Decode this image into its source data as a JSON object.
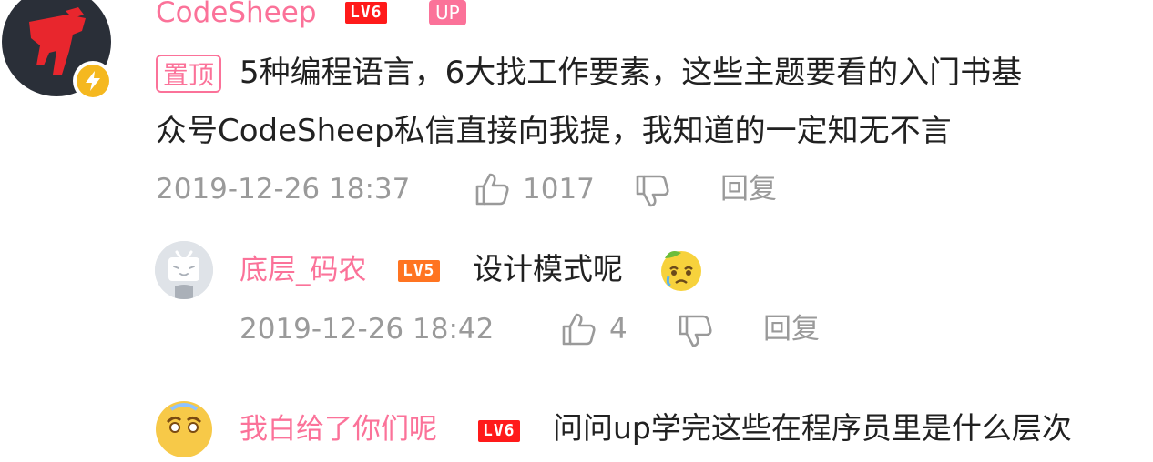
{
  "comment": {
    "username": "CodeSheep",
    "level": "LV6",
    "up_badge": "UP",
    "pin_label": "置顶",
    "content_line1": "5种编程语言，6大找工作要素，这些主题要看的入门书基",
    "content_line2": "众号CodeSheep私信直接向我提，我知道的一定知无不言",
    "timestamp": "2019-12-26 18:37",
    "like_count": "1017",
    "reply_label": "回复"
  },
  "replies": [
    {
      "username": "底层_码农",
      "level": "LV5",
      "text": "设计模式呢",
      "timestamp": "2019-12-26 18:42",
      "like_count": "4",
      "reply_label": "回复"
    },
    {
      "username": "我白给了你们呢",
      "level": "LV6",
      "text": "问问up学完这些在程序员里是什么层次"
    }
  ],
  "colors": {
    "accent_pink": "#fb7299",
    "meta_gray": "#9a9a9a",
    "text_dark": "#212121",
    "level6_red": "#ff1a1a",
    "level5_orange": "#ff7421",
    "verify_yellow": "#f5b81f"
  },
  "icons": {
    "like": "thumbs-up-icon",
    "dislike": "thumbs-down-icon",
    "verified": "lightning-icon",
    "emoji": "crying-face-emoji-icon"
  }
}
